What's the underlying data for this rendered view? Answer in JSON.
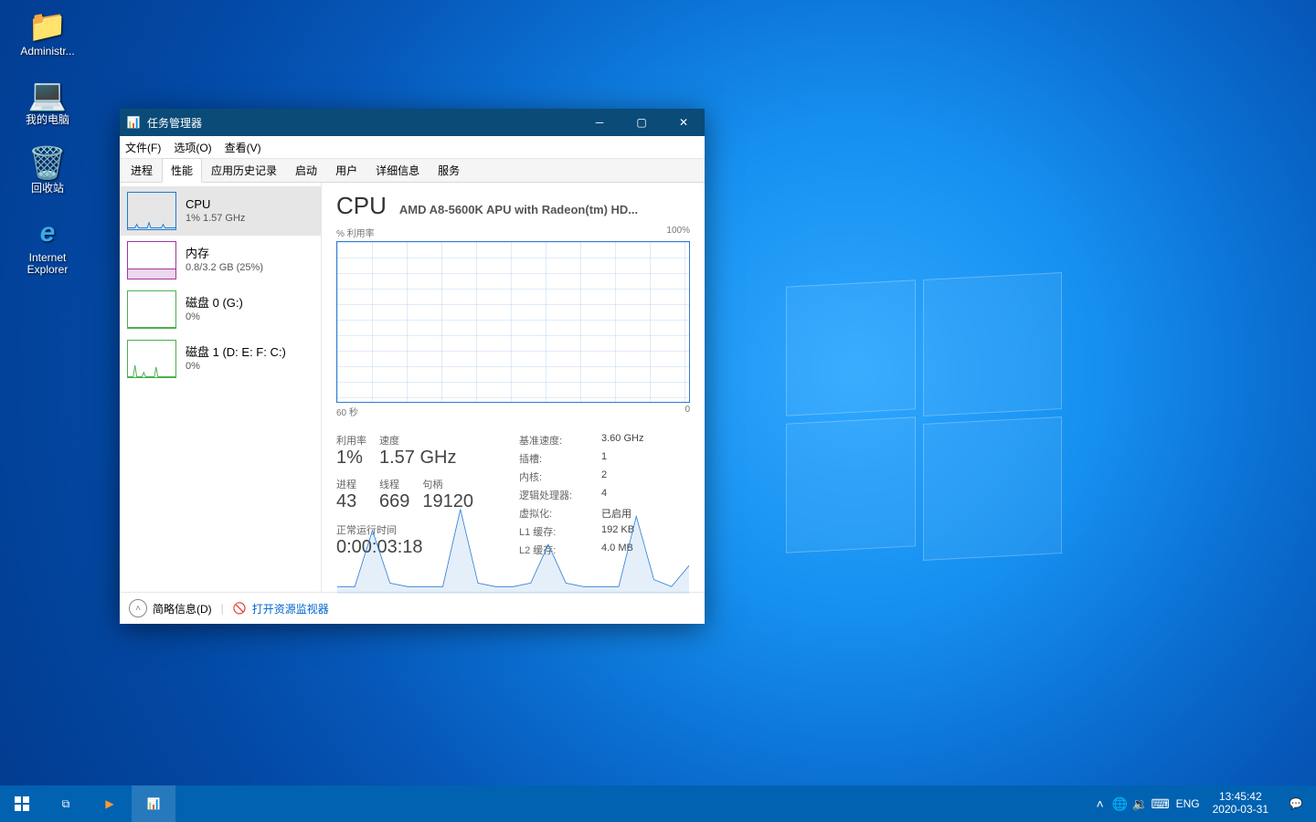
{
  "desktop": {
    "icons": [
      {
        "name": "administrator",
        "label": "Administr..."
      },
      {
        "name": "my-computer",
        "label": "我的电脑"
      },
      {
        "name": "recycle-bin",
        "label": "回收站"
      },
      {
        "name": "internet-explorer",
        "label": "Internet\nExplorer"
      }
    ]
  },
  "window": {
    "title": "任务管理器",
    "menu": [
      "文件(F)",
      "选项(O)",
      "查看(V)"
    ],
    "tabs": [
      "进程",
      "性能",
      "应用历史记录",
      "启动",
      "用户",
      "详细信息",
      "服务"
    ],
    "active_tab": 1,
    "sidebar": [
      {
        "title": "CPU",
        "subtitle": "1% 1.57 GHz",
        "kind": "cpu",
        "selected": true
      },
      {
        "title": "内存",
        "subtitle": "0.8/3.2 GB (25%)",
        "kind": "mem"
      },
      {
        "title": "磁盘 0 (G:)",
        "subtitle": "0%",
        "kind": "disk"
      },
      {
        "title": "磁盘 1 (D: E: F: C:)",
        "subtitle": "0%",
        "kind": "disk"
      }
    ],
    "main": {
      "heading": "CPU",
      "model": "AMD A8-5600K APU with Radeon(tm) HD...",
      "graph_top_left": "% 利用率",
      "graph_top_right": "100%",
      "graph_bottom_left": "60 秒",
      "graph_bottom_right": "0",
      "stats_left": [
        {
          "label": "利用率",
          "value": "1%"
        },
        {
          "label": "速度",
          "value": "1.57 GHz"
        },
        {
          "label": "",
          "value": ""
        },
        {
          "label": "进程",
          "value": "43"
        },
        {
          "label": "线程",
          "value": "669"
        },
        {
          "label": "句柄",
          "value": "19120"
        }
      ],
      "uptime_label": "正常运行时间",
      "uptime_value": "0:00:03:18",
      "stats_right": [
        {
          "k": "基准速度:",
          "v": "3.60 GHz"
        },
        {
          "k": "插槽:",
          "v": "1"
        },
        {
          "k": "内核:",
          "v": "2"
        },
        {
          "k": "逻辑处理器:",
          "v": "4"
        },
        {
          "k": "虚拟化:",
          "v": "已启用"
        },
        {
          "k": "L1 缓存:",
          "v": "192 KB"
        },
        {
          "k": "L2 缓存:",
          "v": "4.0 MB"
        }
      ]
    },
    "footer": {
      "fewer": "简略信息(D)",
      "resmon": "打开资源监视器"
    }
  },
  "taskbar": {
    "lang": "ENG",
    "time": "13:45:42",
    "date": "2020-03-31"
  },
  "chart_data": {
    "type": "line",
    "title": "CPU % 利用率",
    "xlabel": "秒",
    "ylabel": "% 利用率",
    "ylim": [
      0,
      100
    ],
    "xlim": [
      60,
      0
    ],
    "x": [
      60,
      57,
      54,
      51,
      48,
      45,
      42,
      39,
      36,
      33,
      30,
      27,
      24,
      21,
      18,
      15,
      12,
      9,
      6,
      3,
      0
    ],
    "values": [
      2,
      2,
      18,
      3,
      2,
      2,
      2,
      24,
      3,
      2,
      2,
      3,
      14,
      3,
      2,
      2,
      2,
      22,
      4,
      2,
      8
    ]
  }
}
